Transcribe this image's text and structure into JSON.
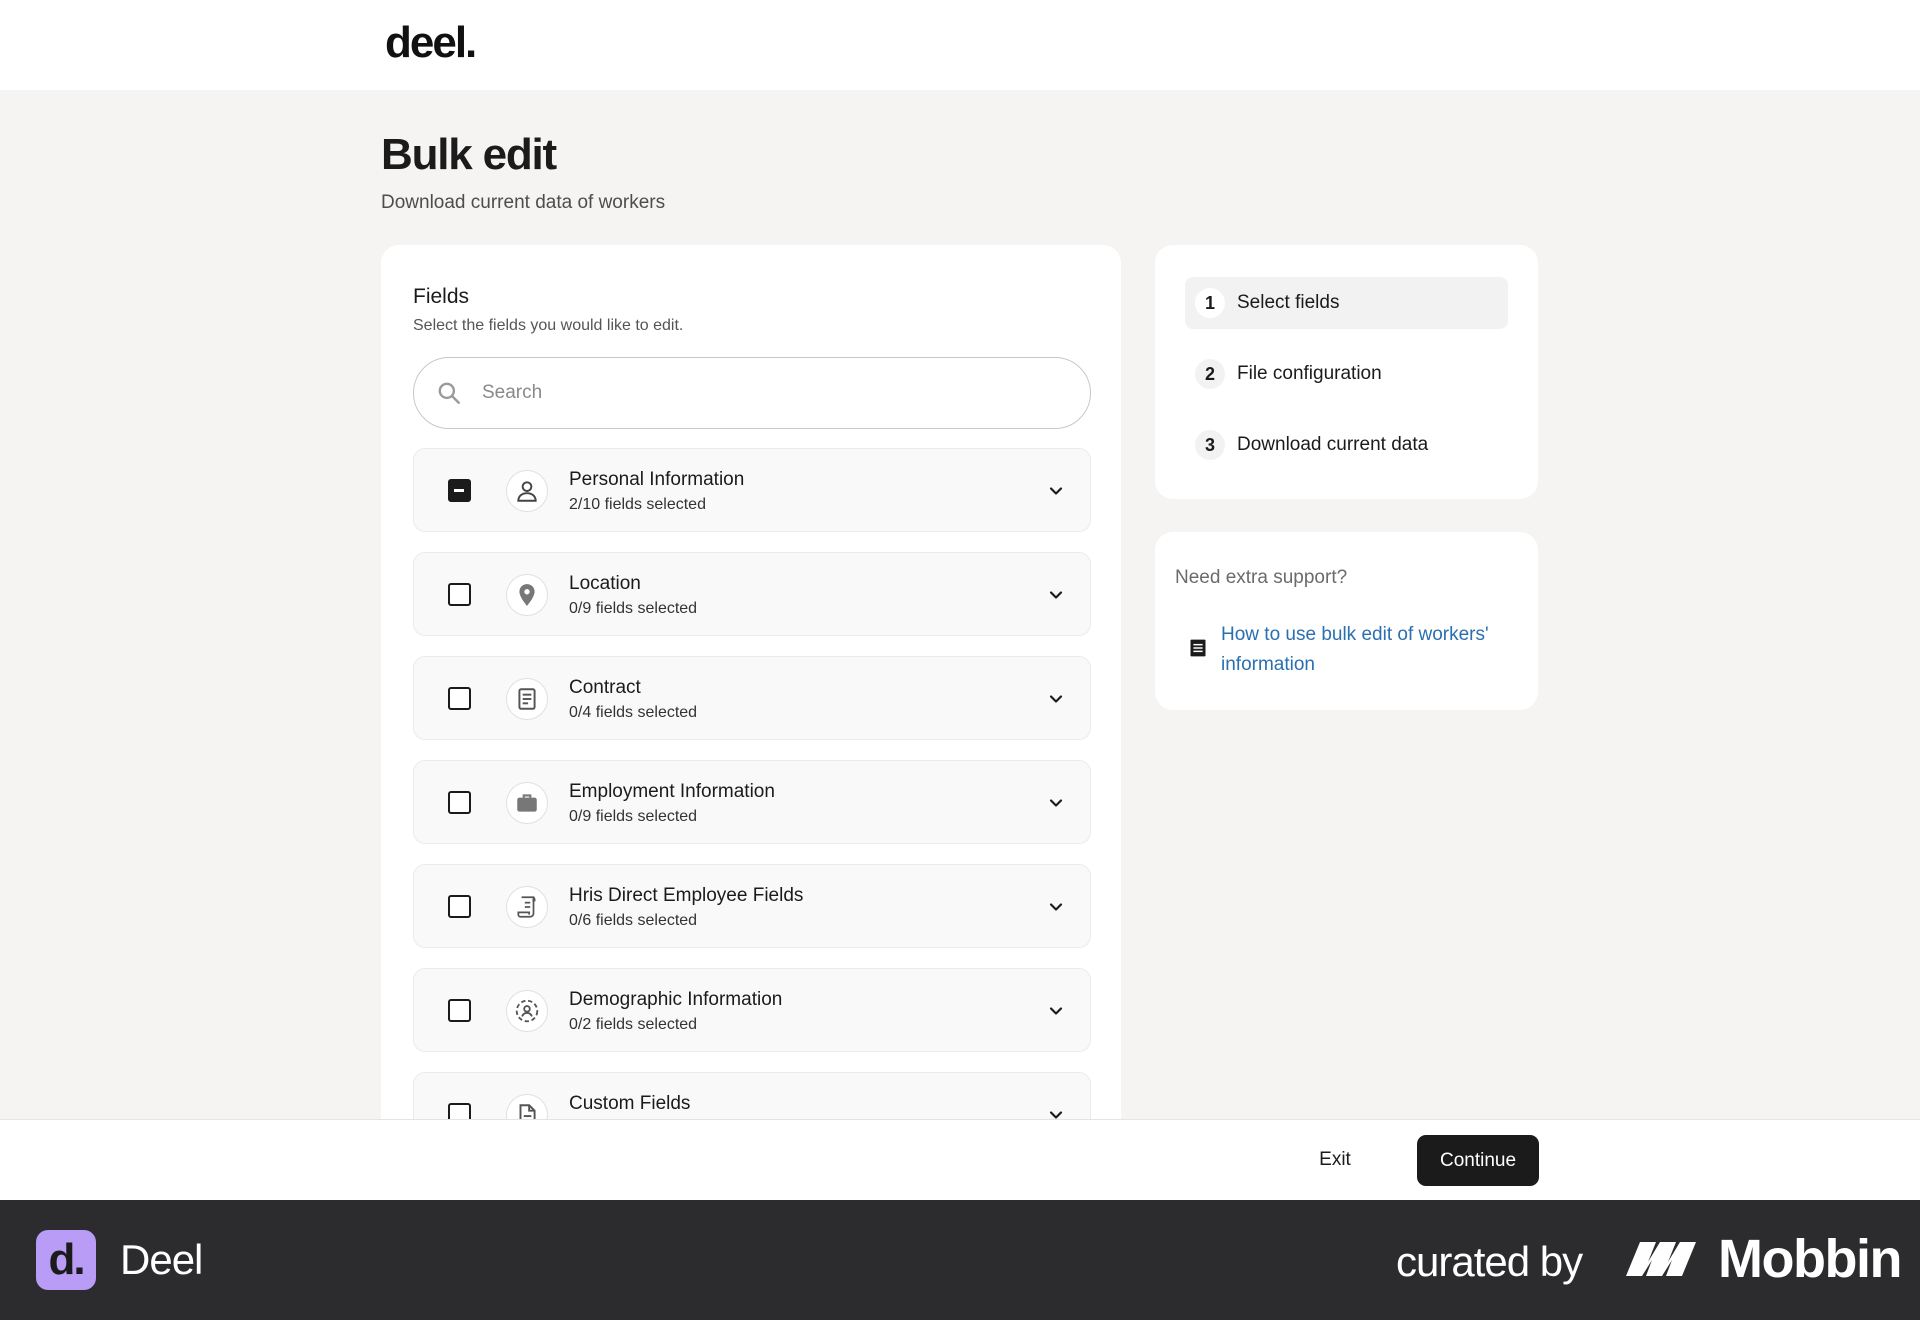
{
  "app": {
    "logo": "deel."
  },
  "page": {
    "title": "Bulk edit",
    "subtitle": "Download current data of workers"
  },
  "fields": {
    "title": "Fields",
    "description": "Select the fields you would like to edit.",
    "search_placeholder": "Search",
    "groups": [
      {
        "name": "Personal Information",
        "count": "2/10 fields selected",
        "icon": "person-icon",
        "state": "partial"
      },
      {
        "name": "Location",
        "count": "0/9 fields selected",
        "icon": "location-pin-icon",
        "state": "unchecked"
      },
      {
        "name": "Contract",
        "count": "0/4 fields selected",
        "icon": "document-icon",
        "state": "unchecked"
      },
      {
        "name": "Employment Information",
        "count": "0/9 fields selected",
        "icon": "briefcase-icon",
        "state": "unchecked"
      },
      {
        "name": "Hris Direct Employee Fields",
        "count": "0/6 fields selected",
        "icon": "scroll-document-icon",
        "state": "unchecked"
      },
      {
        "name": "Demographic Information",
        "count": "0/2 fields selected",
        "icon": "person-circle-icon",
        "state": "unchecked"
      },
      {
        "name": "Custom Fields",
        "count": "",
        "icon": "file-icon",
        "state": "unchecked"
      }
    ]
  },
  "steps": [
    {
      "number": "1",
      "label": "Select fields",
      "active": true
    },
    {
      "number": "2",
      "label": "File configuration",
      "active": false
    },
    {
      "number": "3",
      "label": "Download current data",
      "active": false
    }
  ],
  "support": {
    "title": "Need extra support?",
    "link_text": "How to use bulk edit of workers' information",
    "icon": "article-icon"
  },
  "footer": {
    "exit_label": "Exit",
    "continue_label": "Continue"
  },
  "credit": {
    "badge": "d.",
    "app_name": "Deel",
    "curated_by": "curated by",
    "brand": "Mobbin"
  },
  "colors": {
    "primary_button": "#1b1b1b",
    "link": "#2a6fb0",
    "page_background": "#f5f4f2",
    "deel_badge": "#b89cf5",
    "credit_bar": "#2c2c2e"
  }
}
